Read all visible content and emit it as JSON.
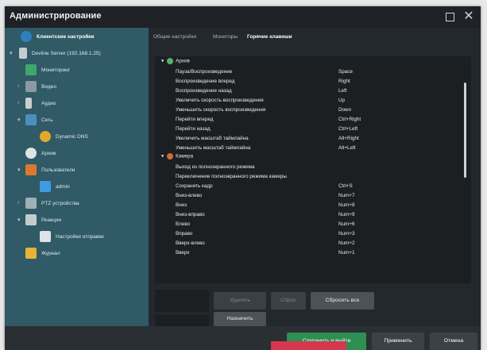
{
  "window": {
    "title": "Администрирование"
  },
  "sidebar": {
    "items": [
      {
        "label": "Клиентские настройки",
        "icon": "gear-icon"
      },
      {
        "label": "Devline Server (192.168.1.25)",
        "icon": "server-icon"
      },
      {
        "label": "Мониторинг",
        "icon": "pulse-icon"
      },
      {
        "label": "Видео",
        "icon": "video-icon"
      },
      {
        "label": "Аудио",
        "icon": "microphone-icon"
      },
      {
        "label": "Сеть",
        "icon": "network-icon"
      },
      {
        "label": "Dynamic DNS",
        "icon": "globe-icon"
      },
      {
        "label": "Архив",
        "icon": "film-reel-icon"
      },
      {
        "label": "Пользователи",
        "icon": "users-icon"
      },
      {
        "label": "admin",
        "icon": "user-icon"
      },
      {
        "label": "PTZ устройства",
        "icon": "ptz-camera-icon"
      },
      {
        "label": "Реакции",
        "icon": "reactions-icon"
      },
      {
        "label": "Настройки отправки",
        "icon": "send-icon"
      },
      {
        "label": "Журнал",
        "icon": "journal-icon"
      }
    ]
  },
  "tabs": [
    {
      "label": "Общие настройки"
    },
    {
      "label": "Мониторы"
    },
    {
      "label": "Горячие клавиши"
    }
  ],
  "hotkeys": {
    "groups": [
      {
        "name": "Архив",
        "rows": [
          {
            "action": "Пауза/Воспроизведение",
            "key": "Space"
          },
          {
            "action": "Воспроизведение вперед",
            "key": "Right"
          },
          {
            "action": "Воспроизведение назад",
            "key": "Left"
          },
          {
            "action": "Увеличить скорость воспроизведения",
            "key": "Up"
          },
          {
            "action": "Уменьшить скорость воспроизведения",
            "key": "Down"
          },
          {
            "action": "Перейти вперед",
            "key": "Ctrl+Right"
          },
          {
            "action": "Перейти назад",
            "key": "Ctrl+Left"
          },
          {
            "action": "Увеличить масштаб таймлайна",
            "key": "Alt+Right"
          },
          {
            "action": "Уменьшить масштаб таймлайна",
            "key": "Alt+Left"
          }
        ]
      },
      {
        "name": "Камера",
        "rows": [
          {
            "action": "Выход из полноэкранного режима",
            "key": ""
          },
          {
            "action": "Переключение полноэкранного режима камеры",
            "key": ""
          },
          {
            "action": "Сохранить кадр",
            "key": "Ctrl+S"
          },
          {
            "action": "Вниз-влево",
            "key": "Num+7"
          },
          {
            "action": "Вниз",
            "key": "Num+8"
          },
          {
            "action": "Вниз-вправо",
            "key": "Num+9"
          },
          {
            "action": "Влево",
            "key": "Num+6"
          },
          {
            "action": "Вправо",
            "key": "Num+3"
          },
          {
            "action": "Вверх-влево",
            "key": "Num+2"
          },
          {
            "action": "Вверх",
            "key": "Num+1"
          }
        ]
      }
    ]
  },
  "actions": {
    "delete_label": "Удалить",
    "reset_label": "Сброс",
    "reset_all_label": "Сбросить все",
    "assign_label": "Назначить"
  },
  "footer": {
    "save_exit_label": "Сохранить и выйти",
    "apply_label": "Применить",
    "cancel_label": "Отмена"
  },
  "colors": {
    "sidebar_bg": "#2f5a66",
    "panel_bg": "#23282c",
    "accent_green": "#2f8f52",
    "accent_pink": "#d5374e"
  }
}
